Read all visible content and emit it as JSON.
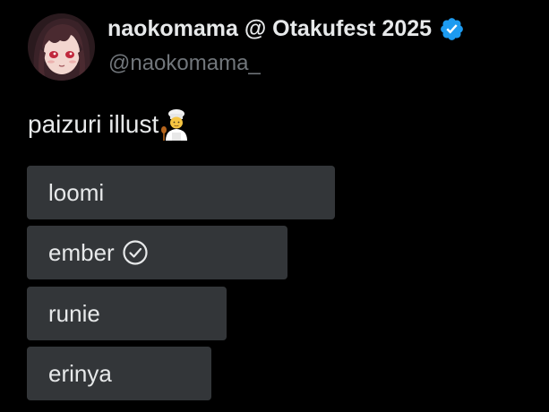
{
  "author": {
    "display_name": "naokomama @ Otakufest 2025",
    "handle": "@naokomama_",
    "verified": true,
    "verified_icon": "verified-badge-icon",
    "avatar_icon": "profile-avatar"
  },
  "post": {
    "text": "paizuri illust",
    "emoji_icon": "cook-emoji-icon"
  },
  "poll": {
    "options": [
      {
        "label": "loomi",
        "selected": false,
        "share": 0.56
      },
      {
        "label": "ember",
        "selected": true,
        "share": 0.47
      },
      {
        "label": "runie",
        "selected": false,
        "share": 0.36
      },
      {
        "label": "erinya",
        "selected": false,
        "share": 0.34
      }
    ]
  },
  "colors": {
    "background": "#000000",
    "text_primary": "#e7e9ea",
    "text_secondary": "#71767b",
    "verified_blue": "#1d9bf0",
    "poll_bar": "#333639"
  }
}
